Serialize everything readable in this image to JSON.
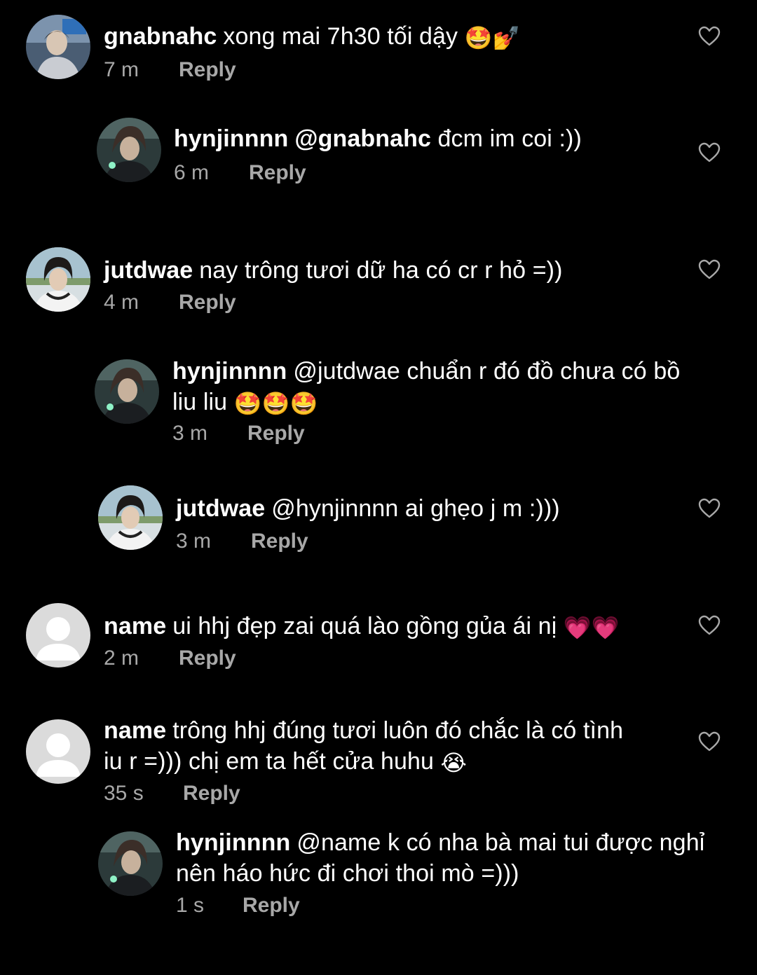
{
  "colors": {
    "background": "#000000",
    "text": "#ffffff",
    "meta": "#a8a8a8",
    "heart_outline": "#a8a8a8"
  },
  "comments": [
    {
      "username": "gnabnahc",
      "text": "xong mai 7h30 tối dậy",
      "emojis": "🤩💅",
      "time": "7 m",
      "reply": "Reply",
      "like_icon": "heart-outline-icon"
    },
    {
      "username": "hynjinnnn",
      "mention": "@gnabnahc",
      "text": "đcm im coi :))",
      "time": "6 m",
      "reply": "Reply",
      "like_icon": "heart-outline-icon"
    },
    {
      "username": "jutdwae",
      "text": "nay trông tươi dữ ha có cr r hỏ =))",
      "time": "4 m",
      "reply": "Reply",
      "like_icon": "heart-outline-icon"
    },
    {
      "username": "hynjinnnn",
      "text_line1": "@jutdwae chuẩn r đó đồ chưa có bồ",
      "text_line2": "liu liu",
      "emojis": "🤩🤩🤩",
      "time": "3 m",
      "reply": "Reply"
    },
    {
      "username": "jutdwae",
      "text": "@hynjinnnn ai ghẹo j m :)))",
      "time": "3 m",
      "reply": "Reply",
      "like_icon": "heart-outline-icon"
    },
    {
      "username": "name",
      "text": "ui hhj đẹp zai quá lào gồng gủa ái nị",
      "emojis": "💗💗",
      "time": "2 m",
      "reply": "Reply",
      "like_icon": "heart-outline-icon"
    },
    {
      "username": "name",
      "text_line1": "trông hhj đúng tươi luôn đó chắc là có tình",
      "text_line2": "iu r =))) chị em ta hết cửa huhu",
      "emojis": "😭",
      "time": "35 s",
      "reply": "Reply",
      "like_icon": "heart-outline-icon"
    },
    {
      "username": "hynjinnnn",
      "text_line1": "@name k có nha bà mai tui được nghỉ",
      "text_line2": "nên háo hức đi chơi thoi mò =)))",
      "time": "1 s",
      "reply": "Reply"
    }
  ]
}
